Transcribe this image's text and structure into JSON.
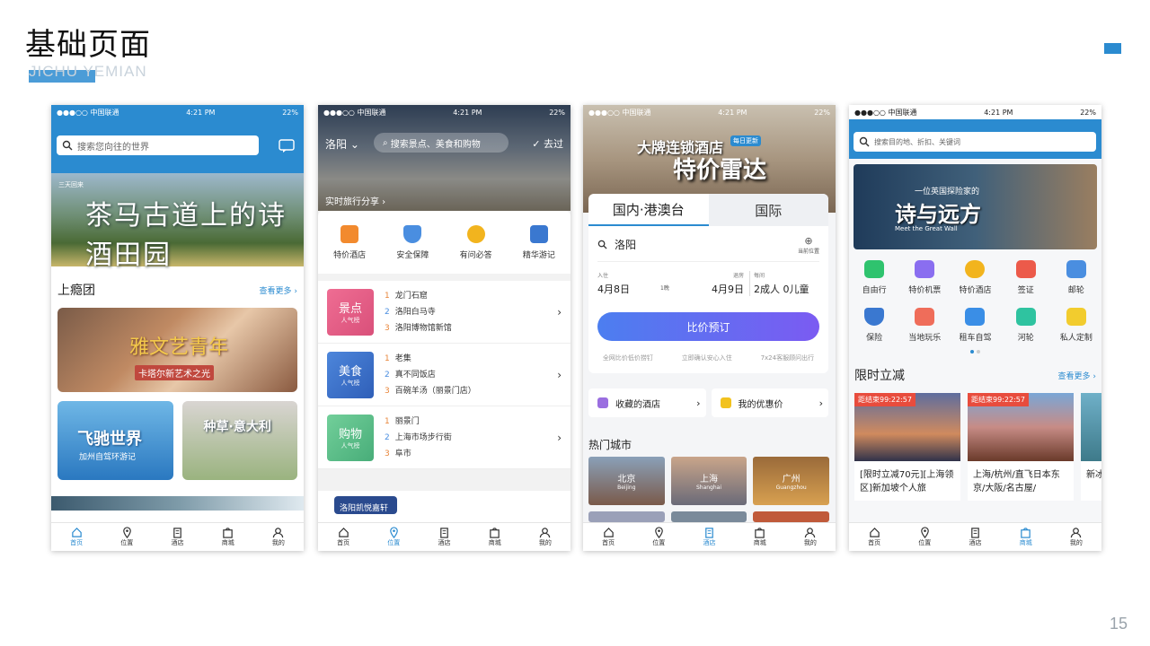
{
  "page": {
    "title": "基础页面",
    "subtitle": "JICHU YEMIAN",
    "page_number": "15"
  },
  "status": {
    "carrier": "●●●○○ 中国联通",
    "time": "4:21 PM",
    "battery": "22%"
  },
  "phone1": {
    "search_placeholder": "搜索您向往的世界",
    "banner_text": "茶马古道上的诗酒田园",
    "banner_logo": "三天回来",
    "section_title": "上瘾团",
    "more": "查看更多 ›",
    "card1_title": "雅文艺青年",
    "card1_sub": "卡塔尔新艺术之光",
    "card2_title": "飞驰世界",
    "card2_sub": "加州自驾环游记",
    "card3_title": "种草·意大利",
    "tabs": [
      "首页",
      "位置",
      "酒店",
      "商城",
      "我的"
    ]
  },
  "phone2": {
    "city": "洛阳",
    "search_placeholder": "搜索景点、美食和购物",
    "visited": "去过",
    "share": "实时旅行分享 ›",
    "cats": [
      "特价酒店",
      "安全保障",
      "有问必答",
      "精华游记"
    ],
    "ranks": [
      {
        "tag": "景点",
        "sub": "人气榜",
        "color": "#e0608a",
        "items": [
          "龙门石窟",
          "洛阳白马寺",
          "洛阳博物馆新馆"
        ]
      },
      {
        "tag": "美食",
        "sub": "人气榜",
        "color": "#3a6fc9",
        "items": [
          "老集",
          "真不同饭店",
          "百碗羊汤（丽景门店）"
        ]
      },
      {
        "tag": "购物",
        "sub": "人气榜",
        "color": "#5dbf8a",
        "items": [
          "丽景门",
          "上海市场步行街",
          "阜市"
        ]
      }
    ],
    "foot_tag": "洛阳凯悦嘉轩",
    "tabs": [
      "首页",
      "位置",
      "酒店",
      "商城",
      "我的"
    ]
  },
  "phone3": {
    "hero_line1": "大牌连锁酒店",
    "hero_line2": "特价雷达",
    "badge": "每日更新",
    "tab_domestic": "国内·港澳台",
    "tab_intl": "国际",
    "city": "洛阳",
    "locate": "当前位置",
    "checkin_label": "入住",
    "checkin": "4月8日",
    "nights": "1晚",
    "checkout_label": "退房",
    "checkout": "4月9日",
    "guests_label": "每间",
    "guests": "2成人  0儿童",
    "book": "比价预订",
    "notes": [
      "全网比价低价捞钉",
      "立即确认安心入住",
      "7x24客服顾问出行"
    ],
    "fav": "收藏的酒店",
    "coupon": "我的优惠价",
    "hot_title": "热门城市",
    "cities": [
      {
        "name": "北京",
        "en": "Beijing"
      },
      {
        "name": "上海",
        "en": "Shanghai"
      },
      {
        "name": "广州",
        "en": "Guangzhou"
      }
    ],
    "tabs": [
      "首页",
      "位置",
      "酒店",
      "商城",
      "我的"
    ]
  },
  "phone4": {
    "search_placeholder": "搜索目的地、折扣、关键词",
    "banner_title": "诗与远方",
    "banner_sub": "一位英国探险家的",
    "banner_en": "Meet the Great Wall",
    "grid": [
      "自由行",
      "特价机票",
      "特价酒店",
      "签证",
      "邮轮",
      "保险",
      "当地玩乐",
      "租车自驾",
      "河轮",
      "私人定制"
    ],
    "section_title": "限时立减",
    "more": "查看更多 ›",
    "deals": [
      {
        "countdown": "距结束99:22:57",
        "text": "[限时立减70元][上海领区]新加坡个人旅"
      },
      {
        "countdown": "距结束99:22:57",
        "text": "上海/杭州/直飞日本东京/大阪/名古屋/"
      }
    ],
    "deal3_text": "新冰",
    "tabs": [
      "首页",
      "位置",
      "酒店",
      "商城",
      "我的"
    ]
  }
}
